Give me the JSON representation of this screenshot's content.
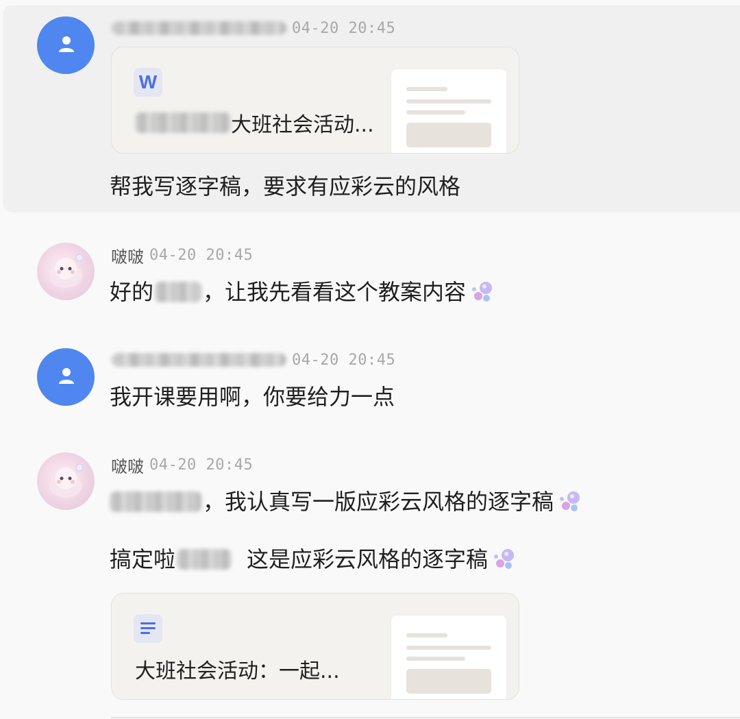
{
  "messages": [
    {
      "time": "04-20 20:45",
      "card": {
        "file_type_icon": "W",
        "title_suffix": "大班社会活动..."
      },
      "text": "帮我写逐字稿，要求有应彩云的风格"
    },
    {
      "sender": "啵啵",
      "time": "04-20 20:45",
      "text_start": "好的",
      "text_end": "，让我先看看这个教案内容"
    },
    {
      "time": "04-20 20:45",
      "text": "我开课要用啊，你要给力一点"
    },
    {
      "sender": "啵啵",
      "time": "04-20 20:45",
      "text_line1_end": "，我认真写一版应彩云风格的逐字稿",
      "text_line2_start": "搞定啦",
      "text_line2_end": "这是应彩云风格的逐字稿",
      "card": {
        "title": "大班社会活动：一起..."
      }
    }
  ],
  "icons": {
    "user_avatar": "person-icon",
    "bot_avatar": "cartoon-avatar",
    "reaction": "bubbles-icon",
    "word_file": "word-file-icon",
    "doc_file": "doc-lines-icon"
  },
  "colors": {
    "user_avatar_bg": "#4f86f0",
    "highlight_bg": "#f0f0f0",
    "card_bg": "#f3f2ef",
    "file_icon_accent": "#4a6fe0"
  }
}
